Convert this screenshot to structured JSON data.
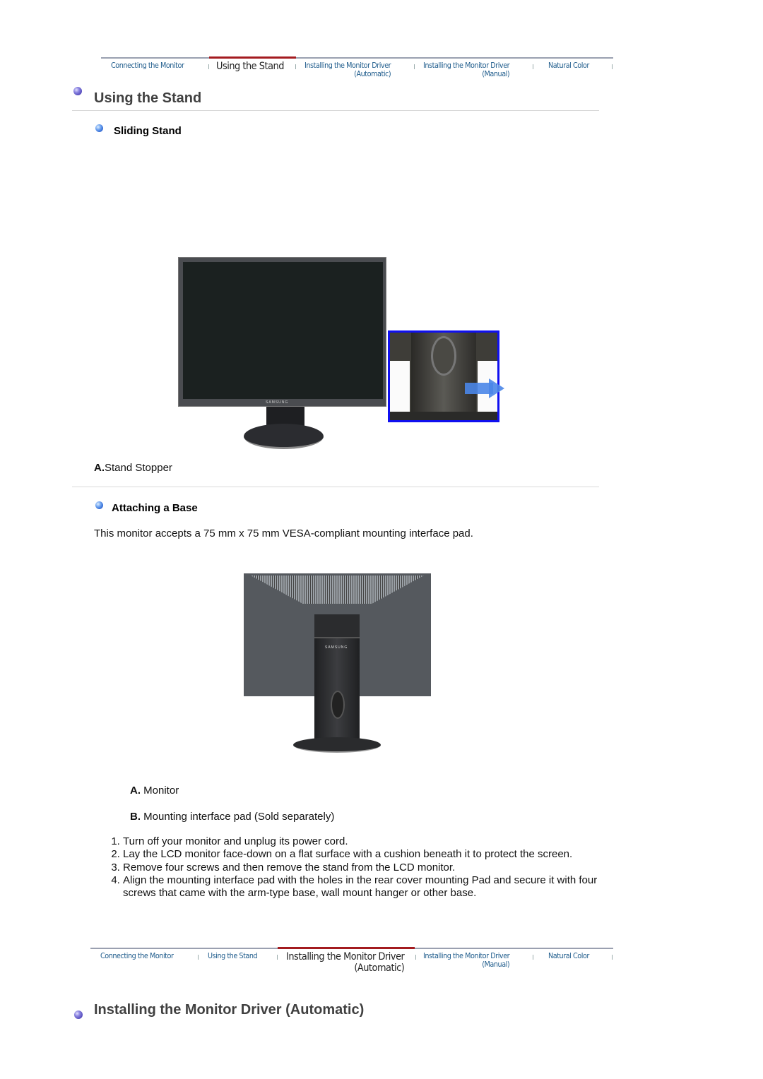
{
  "nav_top": {
    "items": [
      {
        "label": "Connecting  the Monitor",
        "sub": ""
      },
      {
        "label": "Using the Stand",
        "sub": "",
        "active": true
      },
      {
        "label": "Installing the Monitor Driver",
        "sub": "(Automatic)"
      },
      {
        "label": "Installing the Monitor Driver",
        "sub": "(Manual)"
      },
      {
        "label": "Natural Color",
        "sub": ""
      }
    ]
  },
  "section1": {
    "title": "Using the Stand",
    "sub1": {
      "title": "Sliding Stand",
      "figure_brand": "SAMSUNG",
      "caption_label": "A.",
      "caption_text": "Stand Stopper"
    },
    "sub2": {
      "title": "Attaching a Base",
      "intro": "This monitor accepts a 75 mm x 75 mm VESA-compliant mounting interface pad.",
      "figure_brand": "SAMSUNG",
      "parts": [
        {
          "label": "A.",
          "text": " Monitor"
        },
        {
          "label": "B.",
          "text": " Mounting interface pad (Sold separately)"
        }
      ],
      "steps": [
        "Turn off your monitor and unplug its power cord.",
        "Lay the LCD monitor face-down on a flat surface with a cushion beneath it to protect the screen.",
        "Remove four screws and then remove the stand from the LCD monitor.",
        "Align the mounting interface pad with the holes in the rear cover mounting Pad and secure it with four screws that came with the arm-type base, wall mount hanger or other base."
      ]
    }
  },
  "nav_bottom": {
    "items": [
      {
        "label": "Connecting  the Monitor",
        "sub": ""
      },
      {
        "label": "Using the Stand",
        "sub": ""
      },
      {
        "label": "Installing the Monitor Driver",
        "sub": "(Automatic)",
        "active": true
      },
      {
        "label": "Installing the Monitor Driver",
        "sub": "(Manual)"
      },
      {
        "label": "Natural Color",
        "sub": ""
      }
    ]
  },
  "section2": {
    "title": "Installing the Monitor Driver (Automatic)"
  },
  "colors": {
    "nav_link": "#1f5c8c",
    "nav_active_bar": "#a31b1f",
    "heading": "#404040",
    "inset_border": "#1010f0",
    "arrow": "#4a86e8"
  }
}
